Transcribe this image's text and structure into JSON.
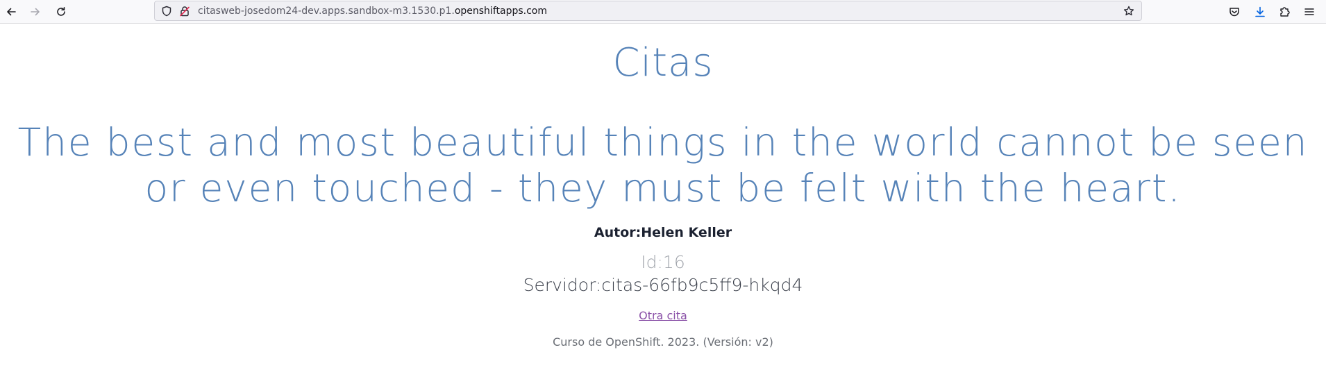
{
  "browser": {
    "url_prefix": "citasweb-josedom24-dev.apps.sandbox-m3.1530.p1.",
    "url_host": "openshiftapps.com"
  },
  "page": {
    "title": "Citas",
    "quote": "The best and most beautiful things in the world cannot be seen or even touched - they must be felt with the heart.",
    "author": "Autor:Helen Keller",
    "id": "Id:16",
    "server": "Servidor:citas-66fb9c5ff9-hkqd4",
    "other_link": "Otra cita",
    "footer": "Curso de OpenShift. 2023. (Versión: v2)"
  },
  "colors": {
    "accent": "#5683b8",
    "link": "#8b52a8",
    "download_active": "#0061e0"
  }
}
